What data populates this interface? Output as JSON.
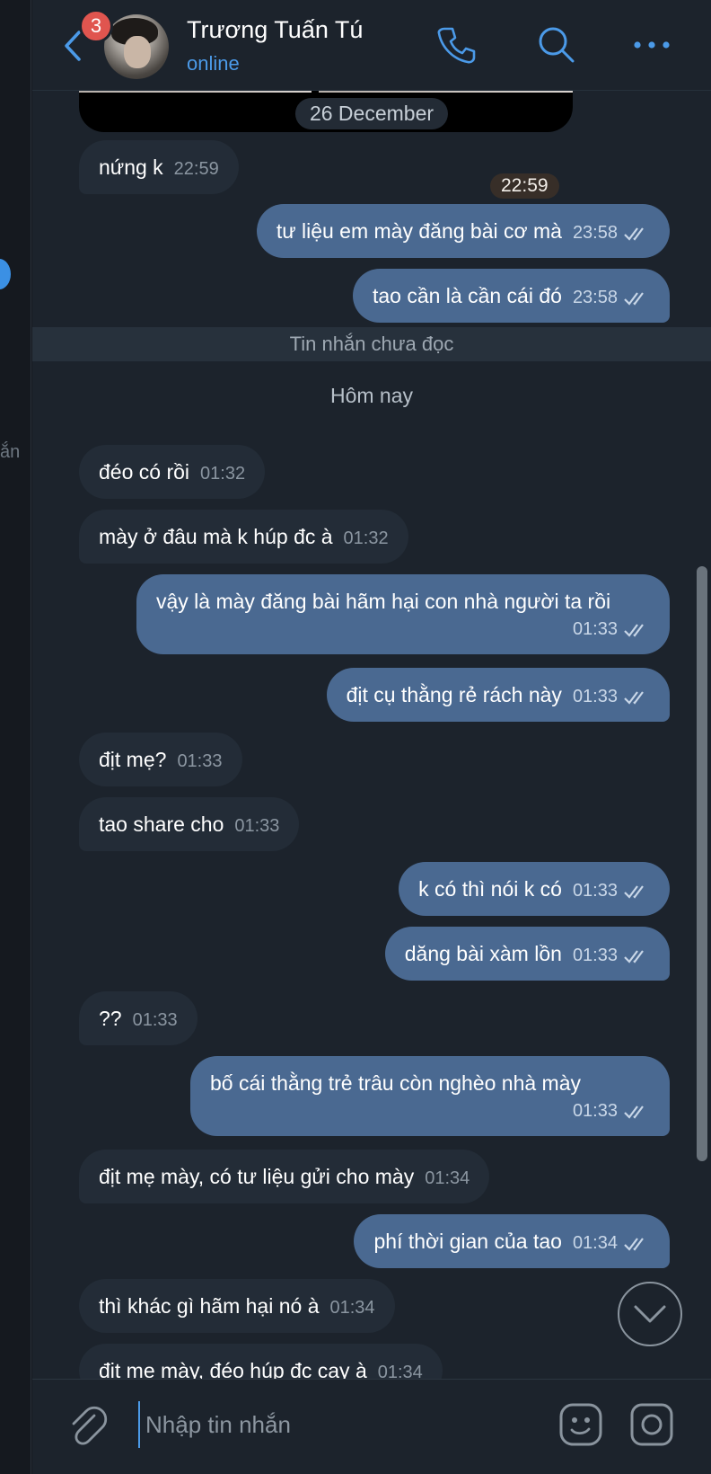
{
  "header": {
    "unread_count": "3",
    "contact_name": "Trương Tuấn Tú",
    "status": "online"
  },
  "side_strip": {
    "partial_text": "ắn"
  },
  "media": {
    "time": "22:59"
  },
  "dates": {
    "previous": "26 December",
    "today": "Hôm nay"
  },
  "unread_divider": "Tin nhắn chưa đọc",
  "messages": [
    {
      "text": "nứng k",
      "time": "22:59",
      "direction": "in"
    },
    {
      "text": "tư liệu em mày đăng bài cơ mà",
      "time": "23:58",
      "direction": "out",
      "read": true
    },
    {
      "text": "tao cần là cần cái đó",
      "time": "23:58",
      "direction": "out",
      "read": true
    },
    {
      "text": "đéo có rồi",
      "time": "01:32",
      "direction": "in"
    },
    {
      "text": "mày ở đâu mà k húp đc à",
      "time": "01:32",
      "direction": "in"
    },
    {
      "text": "vậy là mày đăng bài hãm hại con nhà người ta rồi",
      "time": "01:33",
      "direction": "out",
      "read": true
    },
    {
      "text": "địt cụ thằng rẻ rách này",
      "time": "01:33",
      "direction": "out",
      "read": true
    },
    {
      "text": "địt mẹ?",
      "time": "01:33",
      "direction": "in"
    },
    {
      "text": "tao share cho",
      "time": "01:33",
      "direction": "in"
    },
    {
      "text": "k có thì nói k có",
      "time": "01:33",
      "direction": "out",
      "read": true
    },
    {
      "text": "dăng bài xàm lồn",
      "time": "01:33",
      "direction": "out",
      "read": true
    },
    {
      "text": "??",
      "time": "01:33",
      "direction": "in"
    },
    {
      "text": "bố cái thằng trẻ trâu còn nghèo nhà mày",
      "time": "01:33",
      "direction": "out",
      "read": true
    },
    {
      "text": "địt mẹ mày, có tư liệu gửi cho mày",
      "time": "01:34",
      "direction": "in"
    },
    {
      "text": "phí thời gian của tao",
      "time": "01:34",
      "direction": "out",
      "read": true
    },
    {
      "text": "thì khác gì hãm hại nó à",
      "time": "01:34",
      "direction": "in"
    },
    {
      "text": "địt mẹ mày, đéo húp đc cay à",
      "time": "01:34",
      "direction": "in"
    }
  ],
  "composer": {
    "placeholder": "Nhập tin nhắn"
  },
  "icons": {
    "back": "chevron-left-icon",
    "call": "phone-icon",
    "search": "search-icon",
    "more": "more-horizontal-icon",
    "attach": "paperclip-icon",
    "sticker": "sticker-icon",
    "camera": "camera-icon",
    "scroll_down": "chevron-down-icon",
    "read_receipt": "double-check-icon"
  },
  "colors": {
    "accent": "#4b9ae8",
    "outgoing_bubble": "#4a6991",
    "incoming_bubble": "#232c37",
    "badge": "#e0554f",
    "background": "#1c232c"
  }
}
